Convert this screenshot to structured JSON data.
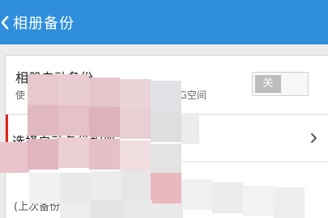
{
  "header": {
    "title": "相册备份",
    "background": "#2f8fdc"
  },
  "auto_backup": {
    "title": "相册自动备份",
    "subtitle_start": "使",
    "subtitle_tail": "5G空间",
    "toggle_label": "关",
    "toggle_on": false
  },
  "select_album": {
    "label": "选择自动备份相册",
    "accent_color": "#e0231b"
  },
  "last_backup": {
    "label": "(上次备份"
  }
}
